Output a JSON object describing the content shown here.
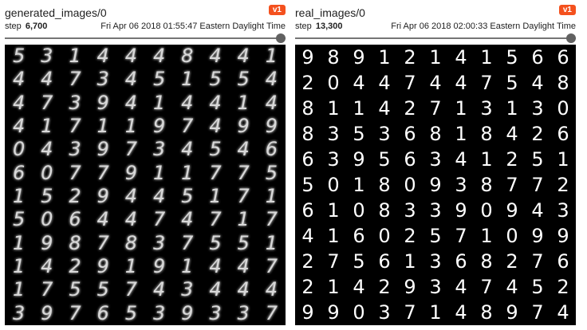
{
  "panels": [
    {
      "title": "generated_images/0",
      "badge": "v1",
      "step_label": "step",
      "step_value": "6,700",
      "timestamp": "Fri Apr 06 2018 01:55:47 Eastern Daylight Time",
      "slider_fraction": 1.0,
      "digits": [
        "5",
        "3",
        "1",
        "4",
        "4",
        "4",
        "8",
        "4",
        "4",
        "1",
        "4",
        "4",
        "7",
        "3",
        "4",
        "5",
        "1",
        "5",
        "5",
        "4",
        "4",
        "7",
        "3",
        "9",
        "4",
        "1",
        "4",
        "4",
        "1",
        "4",
        "4",
        "1",
        "7",
        "1",
        "1",
        "9",
        "7",
        "4",
        "9",
        "9",
        "0",
        "4",
        "3",
        "9",
        "7",
        "3",
        "4",
        "5",
        "4",
        "6",
        "6",
        "0",
        "7",
        "7",
        "9",
        "1",
        "1",
        "7",
        "7",
        "5",
        "1",
        "5",
        "2",
        "9",
        "4",
        "4",
        "5",
        "1",
        "7",
        "1",
        "5",
        "0",
        "6",
        "4",
        "4",
        "7",
        "4",
        "7",
        "1",
        "7",
        "1",
        "9",
        "8",
        "7",
        "8",
        "3",
        "7",
        "5",
        "5",
        "1",
        "1",
        "4",
        "2",
        "9",
        "1",
        "9",
        "1",
        "4",
        "4",
        "7",
        "1",
        "7",
        "5",
        "5",
        "7",
        "4",
        "3",
        "4",
        "4",
        "4",
        "3",
        "9",
        "7",
        "6",
        "5",
        "3",
        "9",
        "3",
        "3",
        "7"
      ]
    },
    {
      "title": "real_images/0",
      "badge": "v1",
      "step_label": "step",
      "step_value": "13,300",
      "timestamp": "Fri Apr 06 2018 02:00:33 Eastern Daylight Time",
      "slider_fraction": 1.0,
      "digits": [
        "9",
        "8",
        "9",
        "1",
        "2",
        "1",
        "4",
        "1",
        "5",
        "6",
        "6",
        "2",
        "0",
        "4",
        "4",
        "7",
        "4",
        "4",
        "7",
        "5",
        "4",
        "8",
        "8",
        "1",
        "1",
        "4",
        "2",
        "7",
        "1",
        "3",
        "1",
        "3",
        "0",
        "8",
        "3",
        "5",
        "3",
        "6",
        "8",
        "1",
        "8",
        "4",
        "2",
        "6",
        "6",
        "3",
        "9",
        "5",
        "6",
        "3",
        "4",
        "1",
        "2",
        "5",
        "1",
        "5",
        "0",
        "1",
        "8",
        "0",
        "9",
        "3",
        "8",
        "7",
        "7",
        "2",
        "6",
        "1",
        "0",
        "8",
        "3",
        "3",
        "9",
        "0",
        "9",
        "4",
        "3",
        "4",
        "1",
        "6",
        "0",
        "2",
        "5",
        "7",
        "1",
        "0",
        "9",
        "9",
        "2",
        "7",
        "5",
        "6",
        "1",
        "3",
        "6",
        "8",
        "2",
        "7",
        "6",
        "2",
        "1",
        "4",
        "2",
        "9",
        "3",
        "4",
        "7",
        "4",
        "5",
        "2",
        "9",
        "9",
        "0",
        "3",
        "7",
        "1",
        "4",
        "8",
        "9",
        "7",
        "4"
      ]
    }
  ]
}
